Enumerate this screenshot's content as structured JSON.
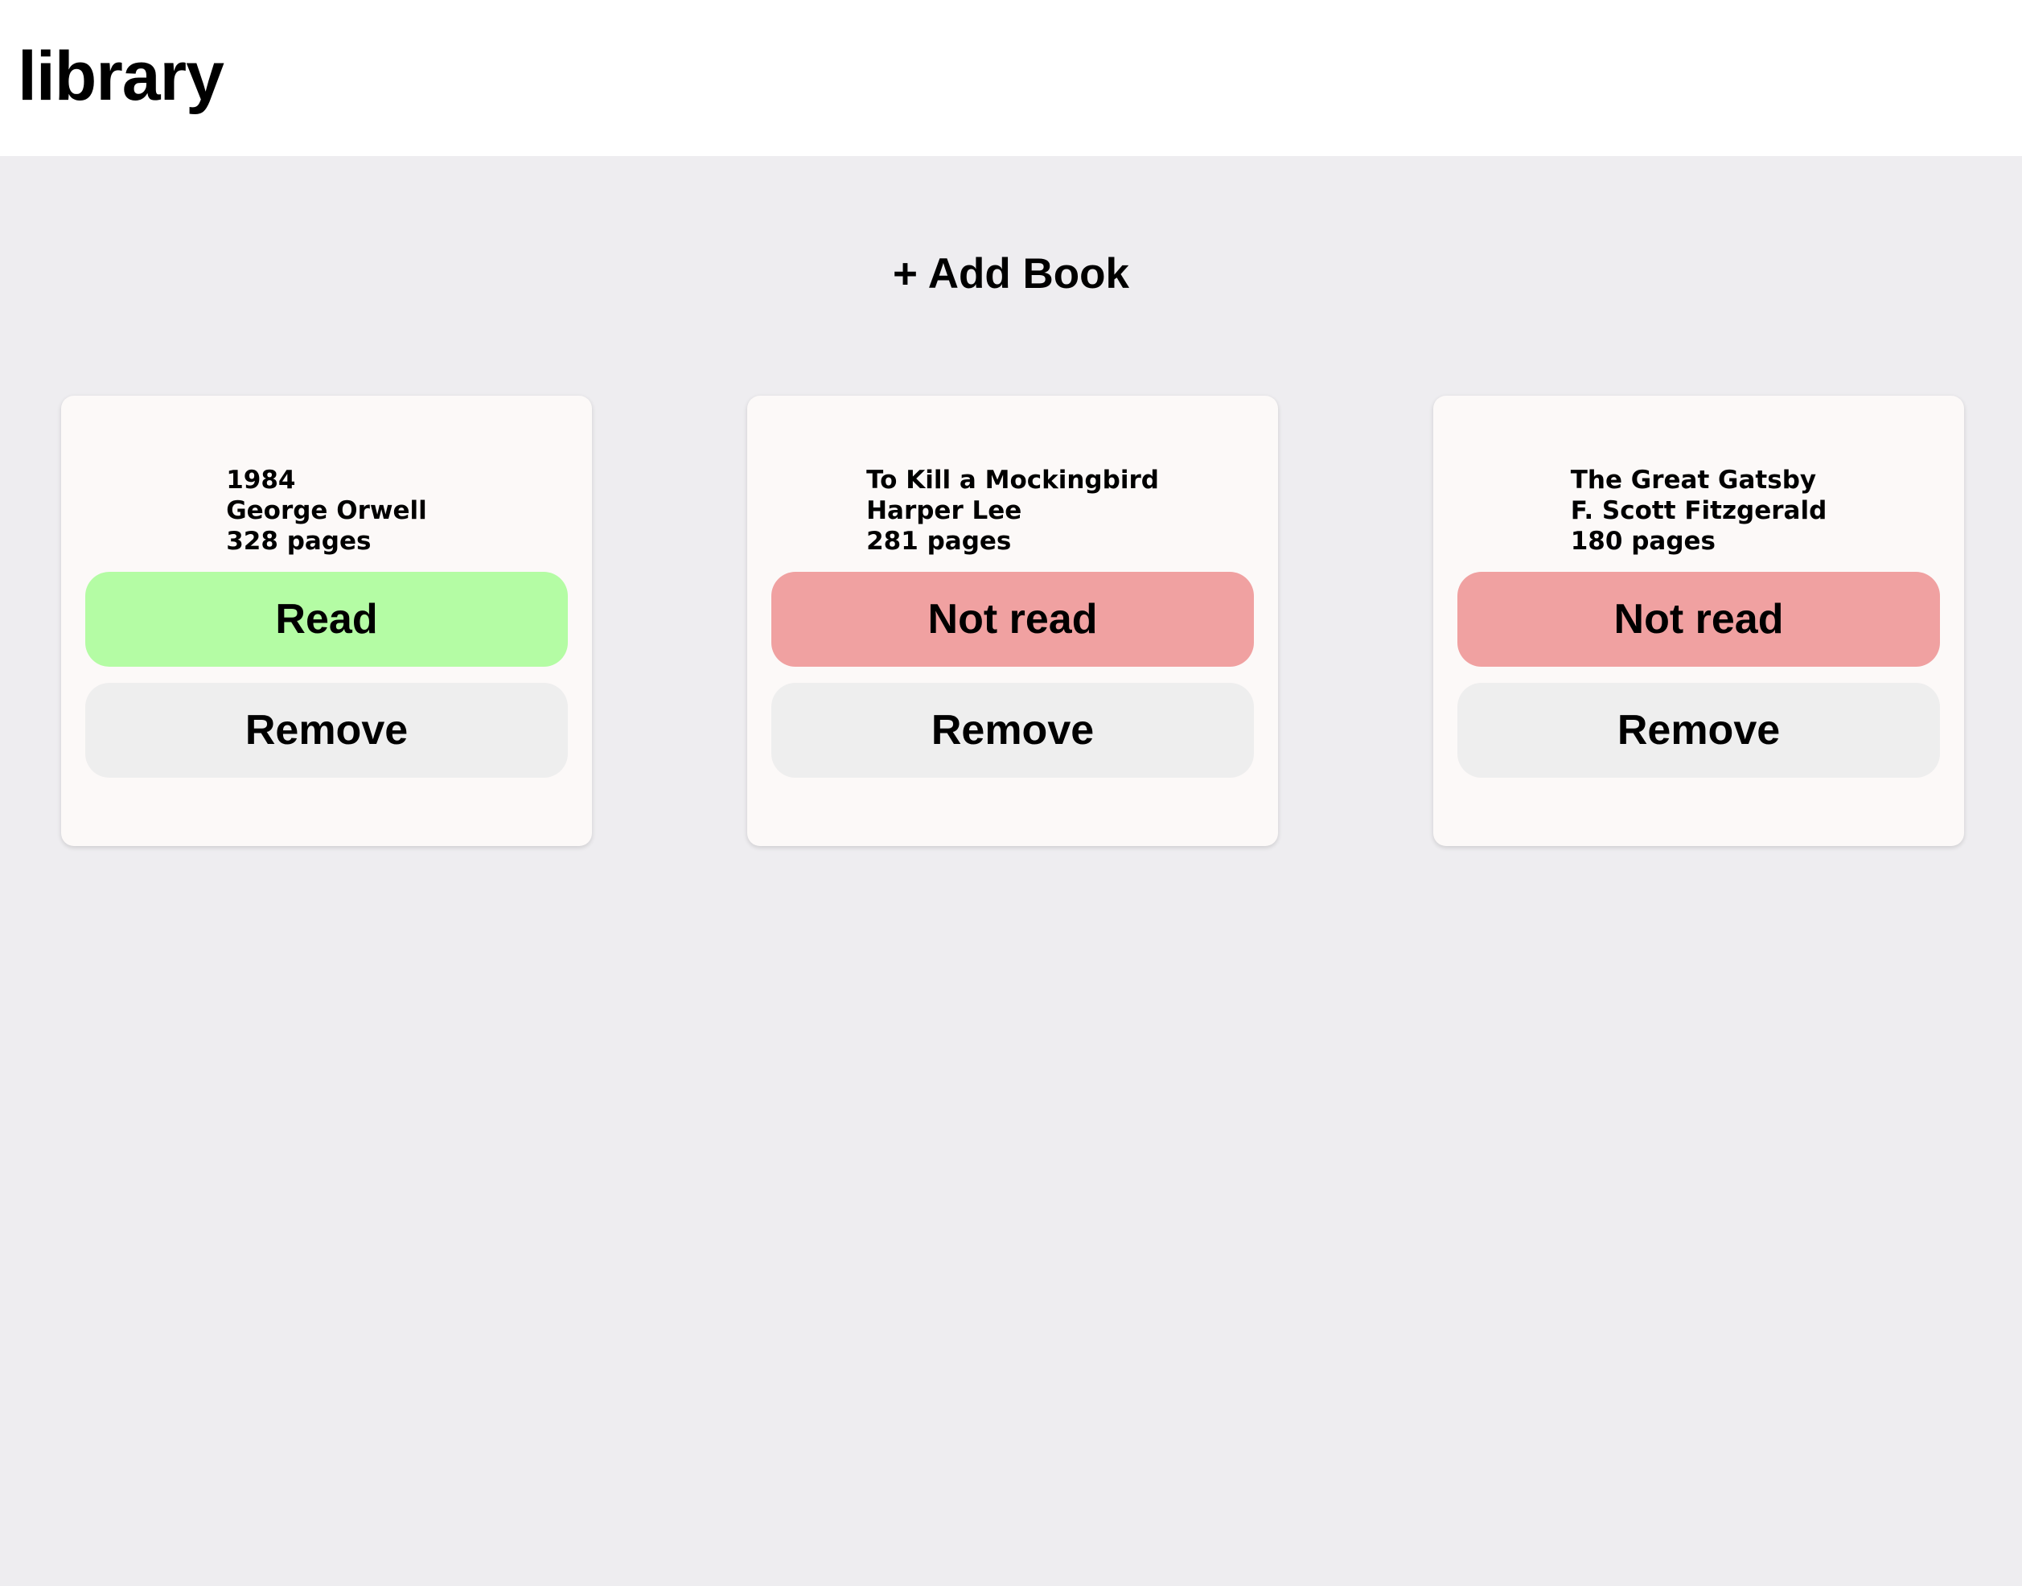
{
  "header": {
    "title": "library"
  },
  "actions": {
    "add_book_label": "+ Add Book"
  },
  "colors": {
    "read": "#b4fca4",
    "not_read": "#f0a1a1",
    "remove": "#eeeeee",
    "card_bg": "#fcf9f8",
    "page_bg": "#eeedf0"
  },
  "books": [
    {
      "title": "1984",
      "author": "George Orwell",
      "pages": "328 pages",
      "status": "Read",
      "remove_label": "Remove"
    },
    {
      "title": "To Kill a Mockingbird",
      "author": "Harper Lee",
      "pages": "281 pages",
      "status": "Not read",
      "remove_label": "Remove"
    },
    {
      "title": "The Great Gatsby",
      "author": "F. Scott Fitzgerald",
      "pages": "180 pages",
      "status": "Not read",
      "remove_label": "Remove"
    }
  ]
}
